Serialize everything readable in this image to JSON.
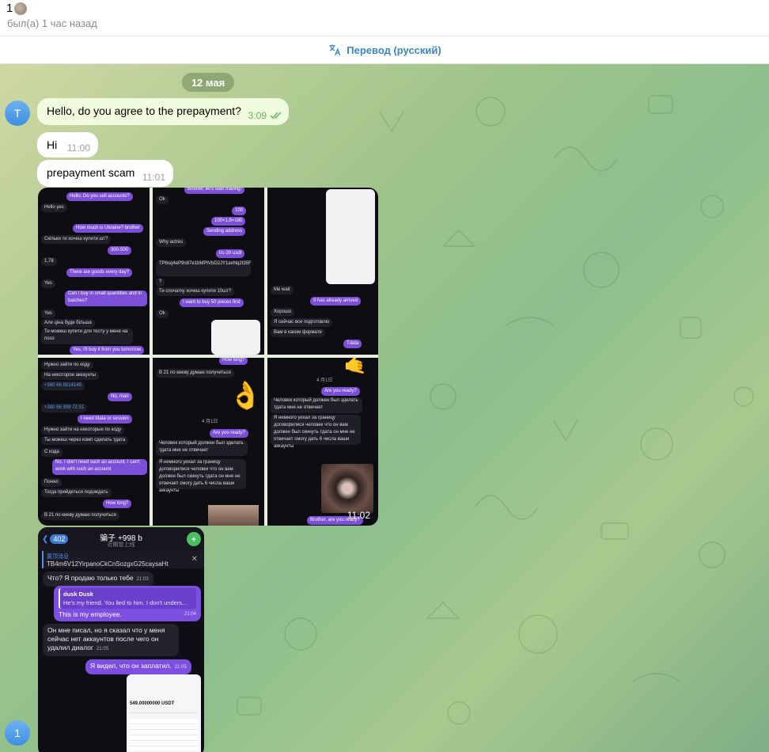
{
  "header": {
    "name": "1",
    "status": "был(а) 1 час назад"
  },
  "translate": {
    "label": "Перевод (русский)"
  },
  "chat": {
    "date": "12 мая",
    "avatar_top_letter": "T",
    "avatar_bottom_letter": "1",
    "messages": [
      {
        "text": "Hello, do you agree to the prepayment?",
        "time": "3:09",
        "outgoing": true
      },
      {
        "text": "Hi",
        "time": "11:00",
        "outgoing": false
      },
      {
        "text": "prepayment scam",
        "time": "11:01",
        "outgoing": false
      }
    ],
    "media_time": "11:02",
    "screenshots": {
      "s1": [
        "Hello, Do you sell accounts?",
        "Hello yes",
        "How much is Ukraine? brother",
        "Скільки ти хочеш купити шт?",
        "300-500",
        "1,78",
        "There are goods every day?",
        "Yes",
        "Can I buy in small quantities and in batches?",
        "Yes",
        "Але ціна буде більша",
        "Ти можеш купити для тесту у мене на пооз",
        "Yes, I'll buy it from you tomorrow"
      ],
      "s2": [
        "Brother, let's start trading!",
        "Ok",
        "100",
        "100×1.8=180",
        "Sending address",
        "Why actres",
        "trc-20 usdt",
        "TPbsq4eP9n87e1bMPtVbD2JY1axNq2t35F",
        "?",
        "Ти спочатку хочеш купити 10шт?",
        "I want to buy 50 pieces first",
        "Ok"
      ],
      "s3": [
        "Me wait",
        "It has already arrived",
        "Хорошо",
        "Я сейчас все подготовлю",
        "Вам в каком формате",
        "Tdata"
      ],
      "s4": [
        "Нужно зайти по коду",
        "На некоторое аккаунты",
        "+380 66 8514149",
        "No, man",
        "+380 66 309 72 51",
        "I need tdata or session",
        "Нужно зайти на некоторые по коду",
        "Ты можеш через комп сделать тдата",
        "С кода",
        "No, I don't need such an account. I can't work with such an account",
        "Понял",
        "Тогда прийдеться подождать",
        "How long?",
        "В 21 по киеву думаю получиться"
      ],
      "s5": [
        "How long?",
        "В 21 по киеву думаю получиться",
        "4 月1日",
        "Are you ready?",
        "Человек который должен был зделать тдата мне не отвечает",
        "Я немного уехал за границу договорилися человек что он вам должен был скинуть тдата он мне не отвечает смогу дать 6 числа ваши аккаунты"
      ],
      "s6": [
        "4 月1日",
        "Are you ready?",
        "Человек который должен был зделать тдата мне не отвечает",
        "Я немного уехал за границу договорилися человек что он вам должен был скинуть тдата он мне не отвечает смогу дать 6 числа ваши аккаунты",
        "Brother, are you ready?"
      ]
    },
    "screenshot2": {
      "back_badge": "402",
      "title": "骗子 +998 b",
      "subtitle": "近期曾上线",
      "pinned_label": "置顶消息",
      "pinned_text": "TB4m6V12YirpanoCkCnSozgxG25caysaHt",
      "msg1": "Что? Я продаю только тебе",
      "msg1_time": "21:03",
      "quote_name": "dusk Dusk",
      "quote_text": "He's my friend. You lied to him. I don't unders...",
      "msg2": "This is my employee.",
      "msg2_time": "21:04",
      "msg3": "Он мне писал, но я сказал что у меня сейчас нет аккаунтов после чего он удалил диалог",
      "msg3_time": "21:05",
      "msg4": "Я видел, что он заплатил.",
      "msg4_time": "21:05",
      "phone_amount": "549.00000000 USDT"
    }
  }
}
